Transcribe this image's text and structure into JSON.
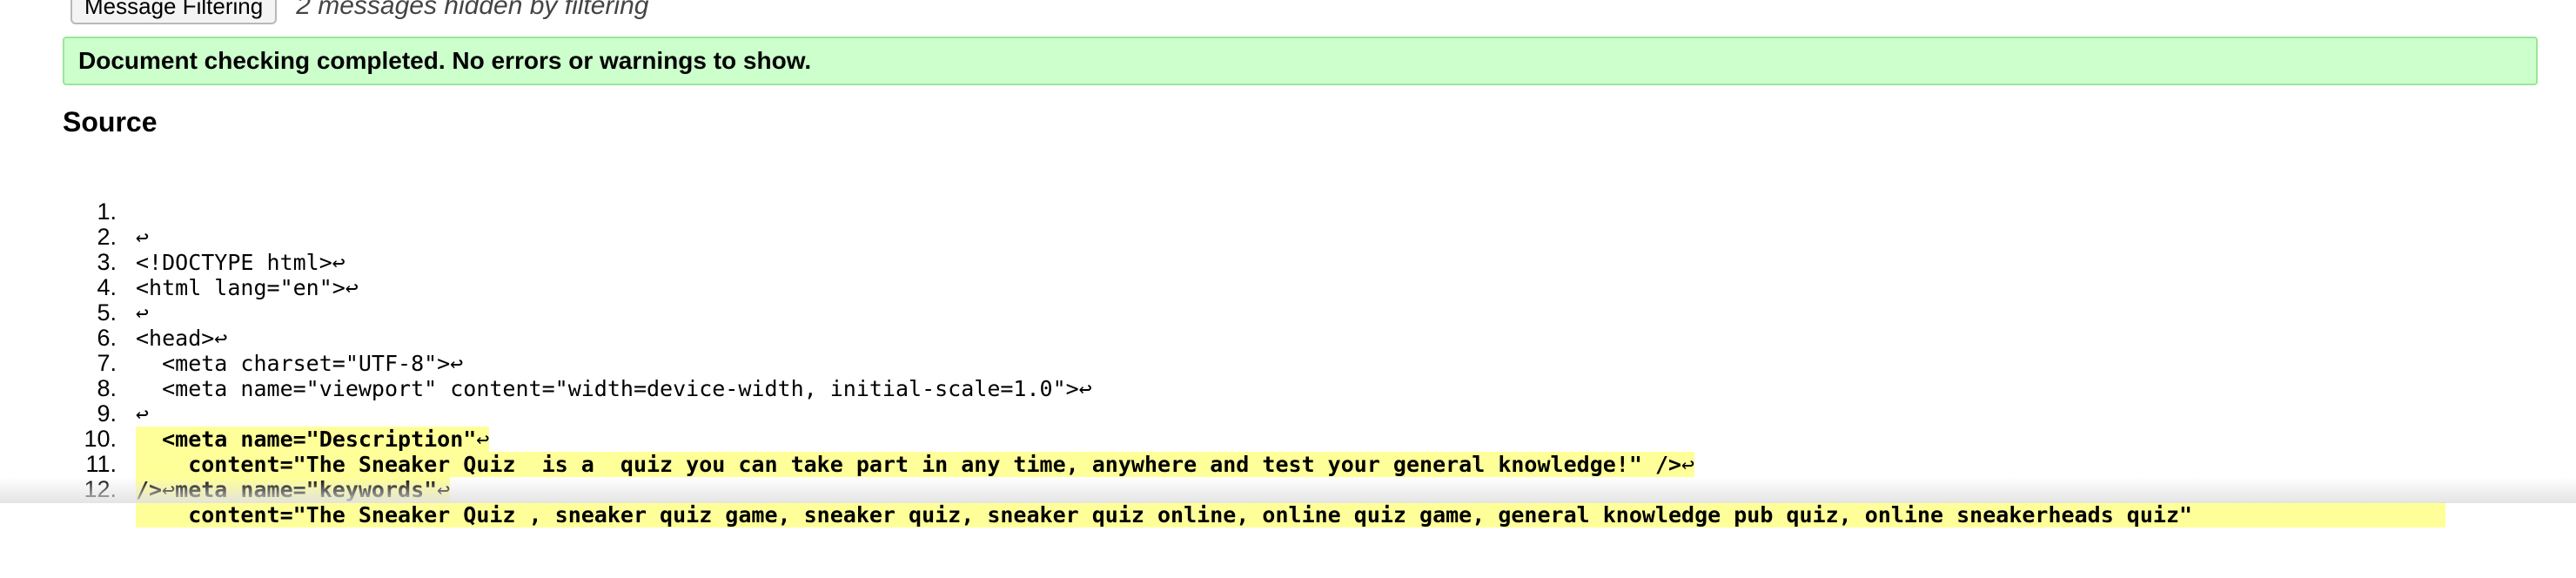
{
  "toolbar": {
    "filter_button_label": "Message Filtering",
    "hidden_messages_text": "2 messages hidden by filtering"
  },
  "status": {
    "message": "Document checking completed. No errors or warnings to show.",
    "background_color": "#ccffcc"
  },
  "source": {
    "heading": "Source",
    "newline_glyph": "↩",
    "highlight_color": "#ffff99",
    "lines": [
      {
        "num": "1.",
        "text": ""
      },
      {
        "num": "2.",
        "text": "<!DOCTYPE html>"
      },
      {
        "num": "3.",
        "text": "<html lang=\"en\">"
      },
      {
        "num": "4.",
        "text": ""
      },
      {
        "num": "5.",
        "text": "<head>"
      },
      {
        "num": "6.",
        "text": "  <meta charset=\"UTF-8\">"
      },
      {
        "num": "7.",
        "text": "  <meta name=\"viewport\" content=\"width=device-width, initial-scale=1.0\">"
      },
      {
        "num": "8.",
        "text": ""
      },
      {
        "num": "9.",
        "text": "  <meta name=\"Description\""
      },
      {
        "num": "10.",
        "text": "    content=\"The Sneaker Quiz  is a  quiz you can take part in any time, anywhere and test your general knowledge!\" />"
      },
      {
        "num": "11.",
        "text": "  <meta name=\"keywords\""
      },
      {
        "num": "12.",
        "text": "    content=\"The Sneaker Quiz , sneaker quiz game, sneaker quiz, sneaker quiz online, online quiz game, general knowledge pub quiz, online sneakerheads quiz\"",
        "continuation": "/>"
      }
    ]
  }
}
